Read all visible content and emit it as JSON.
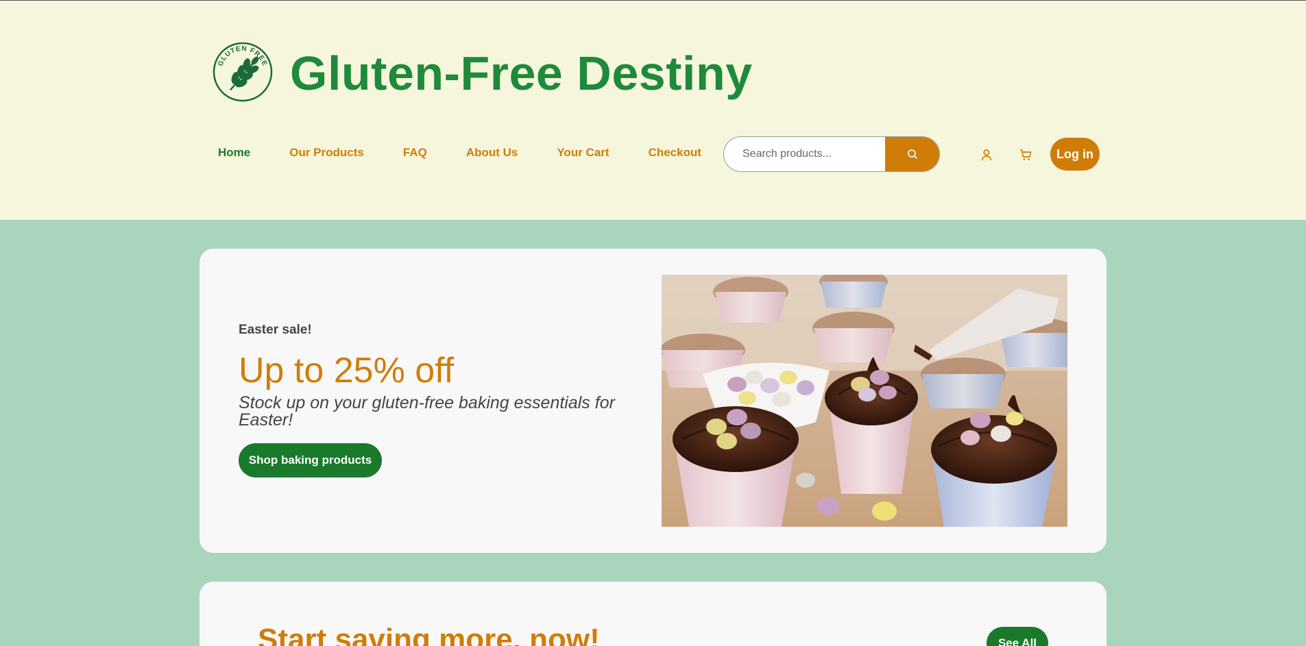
{
  "header": {
    "logo_text": "GLUTEN FREE",
    "site_title": "Gluten-Free Destiny",
    "brand_color": "#1e8a3a",
    "accent_color": "#d07d08"
  },
  "nav": {
    "items": [
      {
        "label": "Home",
        "active": true
      },
      {
        "label": "Our Products",
        "active": false
      },
      {
        "label": "FAQ",
        "active": false
      },
      {
        "label": "About Us",
        "active": false
      },
      {
        "label": "Your Cart",
        "active": false
      },
      {
        "label": "Checkout",
        "active": false
      }
    ]
  },
  "search": {
    "placeholder": "Search products...",
    "value": "",
    "button_icon": "search-icon"
  },
  "actions": {
    "account_icon": "user-icon",
    "cart_icon": "cart-icon",
    "login_label": "Log in"
  },
  "hero": {
    "eyebrow": "Easter sale!",
    "title": "Up to 25% off",
    "subtitle": "Stock up on your gluten-free baking essentials for Easter!",
    "cta_label": "Shop baking products"
  },
  "promo_section": {
    "title": "Start saving more, now!",
    "see_all_label": "See All"
  }
}
